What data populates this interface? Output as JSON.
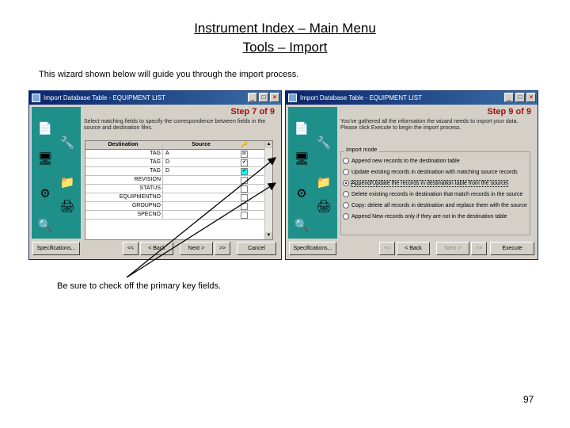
{
  "slide": {
    "title_line1": "Instrument Index – Main Menu",
    "title_line2": "Tools – Import",
    "intro": "This wizard shown below will guide you through the import process.",
    "note": "Be sure to check off the primary key fields.",
    "page_number": "97"
  },
  "dialog1": {
    "title": "Import Database Table - EQUIPMENT LIST",
    "step": "Step 7 of 9",
    "description": "Select matching fields to specify the correspondence between fields in the source and destination files.",
    "columns": {
      "destination": "Destination",
      "source": "Source",
      "key": "🔑"
    },
    "rows": [
      {
        "destination": "TAG",
        "source": "A",
        "key": "☒"
      },
      {
        "destination": "TAG",
        "source": "D",
        "key": "✔"
      },
      {
        "destination": "TAG",
        "source": "D",
        "key": "✔"
      },
      {
        "destination": "REVISION",
        "source": "",
        "key": ""
      },
      {
        "destination": "STATUS",
        "source": "",
        "key": ""
      },
      {
        "destination": "EQUIPMENTNO",
        "source": "",
        "key": ""
      },
      {
        "destination": "GROUPNO",
        "source": "",
        "key": ""
      },
      {
        "destination": "SPECNO",
        "source": "",
        "key": ""
      }
    ],
    "buttons": {
      "specifications": "Specifications...",
      "first": "<<",
      "back": "< Back",
      "next": "Next >",
      "last": ">>",
      "cancel": "Cancel"
    }
  },
  "dialog2": {
    "title": "Import Database Table - EQUIPMENT LIST",
    "step": "Step 9 of 9",
    "description": "You've gathered all the information the wizard needs to import your data. Please click Execute to begin the import process.",
    "group_label": "Import mode",
    "options": [
      {
        "label": "Append new records to the destination table",
        "selected": false
      },
      {
        "label": "Update existing records in destination with matching source records",
        "selected": false
      },
      {
        "label": "Append/Update the records in destination table from the source",
        "selected": true
      },
      {
        "label": "Delete existing records in destination that match records in the source",
        "selected": false
      },
      {
        "label": "Copy: delete all records in destination and replace them with the source",
        "selected": false
      },
      {
        "label": "Append New records only if they are not in the destination table",
        "selected": false
      }
    ],
    "buttons": {
      "specifications": "Specifications...",
      "first": "<<",
      "back": "< Back",
      "next": "Next >",
      "last": ">>",
      "execute": "Execute"
    }
  }
}
